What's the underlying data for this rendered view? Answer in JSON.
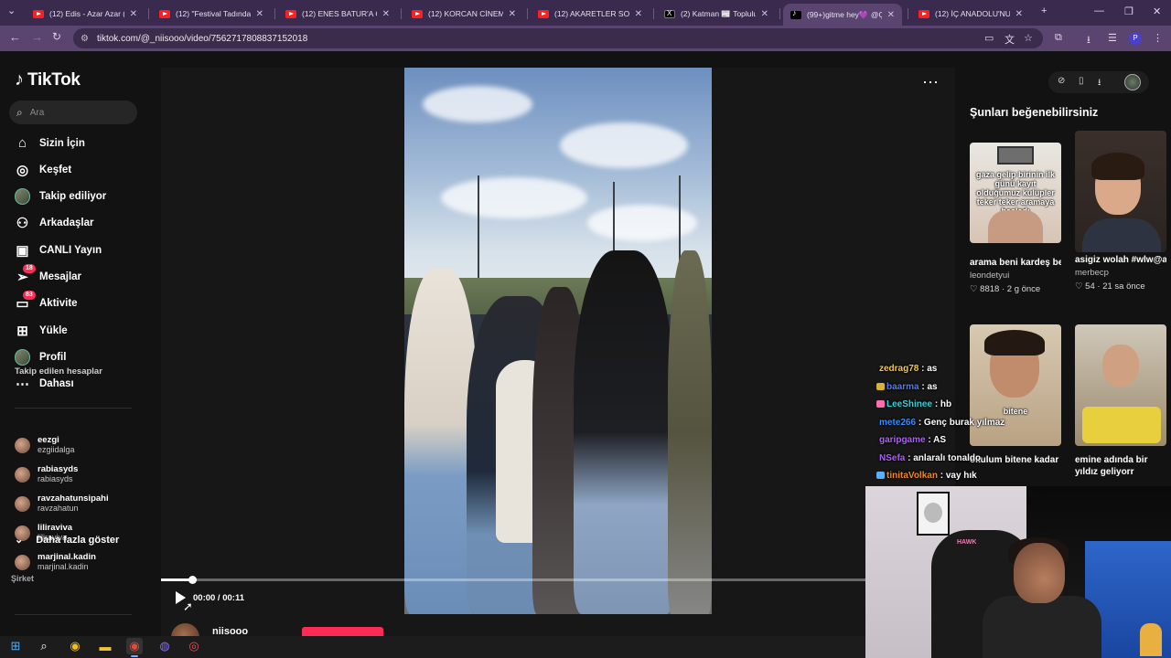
{
  "browser": {
    "tabs": [
      {
        "title": "(12) Edis - Azar Azar (Offi",
        "icon": "youtube-icon"
      },
      {
        "title": "(12) \"Festival Tadında Vid",
        "icon": "youtube-icon"
      },
      {
        "title": "(12) ENES BATUR'A GERÇ",
        "icon": "youtube-icon"
      },
      {
        "title": "(12) KORCAN CİNEMRE E",
        "icon": "youtube-icon"
      },
      {
        "title": "(12) AKARETLER SOKO LE",
        "icon": "youtube-icon"
      },
      {
        "title": "(2) Katman 📰 Topluluk /",
        "icon": "x-icon"
      },
      {
        "title": "(99+)gitme hey💜 @Çağ",
        "icon": "tiktok-icon"
      },
      {
        "title": "(12) İÇ ANADOLU'NUN E",
        "icon": "youtube-icon"
      }
    ],
    "active_tab_index": 6,
    "url": "tiktok.com/@_niisooo/video/7562717808837152018",
    "profile_initial": "P"
  },
  "tiktok": {
    "brand": "TikTok",
    "search_placeholder": "Ara",
    "nav": [
      {
        "label": "Sizin İçin",
        "icon": "home-icon"
      },
      {
        "label": "Keşfet",
        "icon": "compass-icon"
      },
      {
        "label": "Takip ediliyor",
        "icon": "avatar"
      },
      {
        "label": "Arkadaşlar",
        "icon": "friends-icon"
      },
      {
        "label": "CANLI Yayın",
        "icon": "live-icon"
      },
      {
        "label": "Mesajlar",
        "icon": "send-icon",
        "badge": "18"
      },
      {
        "label": "Aktivite",
        "icon": "activity-icon",
        "badge": "83"
      },
      {
        "label": "Yükle",
        "icon": "upload-icon"
      },
      {
        "label": "Profil",
        "icon": "avatar"
      },
      {
        "label": "Dahası",
        "icon": "more-icon"
      }
    ],
    "following_header": "Takip edilen hesaplar",
    "following": [
      {
        "name": "eezgi",
        "username": "ezgiidalga"
      },
      {
        "name": "rabiasyds",
        "username": "rabiasyds"
      },
      {
        "name": "ravzahatunsipahi",
        "username": "ravzahatun"
      },
      {
        "name": "liliraviva",
        "username": "liliraviva"
      },
      {
        "name": "marjinal.kadin",
        "username": "marjinal.kadin"
      }
    ],
    "show_more": "Daha fazla göster",
    "company": "Şirket",
    "player": {
      "time": "00:00 / 00:11",
      "progress": 0.044
    },
    "author_name": "niisooo",
    "recommend_title": "Şunları beğenebilirsiniz",
    "recommendations": [
      {
        "caption": "arama beni kardeş ben gelmicem...",
        "user": "leondetyui",
        "likes": "8818",
        "age": "2 g önce",
        "overlay": "gaza gelip birinin ilk günü kayıt olduğumuz kulüpler teker teker aramaya başladı"
      },
      {
        "caption": "asigiz wolah #wlw@asliihira @e...",
        "user": "merbecp",
        "likes": "54",
        "age": "21 sa önce",
        "overlay": ""
      },
      {
        "caption": "okulum bitene kadar ders",
        "user": "",
        "likes": "",
        "age": "",
        "overlay": "bitene"
      },
      {
        "caption": "emine adında bir yıldız geliyorr",
        "user": "",
        "likes": "",
        "age": "",
        "overlay": ""
      }
    ]
  },
  "stream_chat": [
    {
      "user": "zedrag78",
      "text": ": as",
      "color": "#f5c842"
    },
    {
      "user": "baarma",
      "text": ": as",
      "color": "#4a7bff"
    },
    {
      "user": "LeeShinee",
      "text": ": hb",
      "color": "#3ad0d8"
    },
    {
      "user": "mete266",
      "text": ": Genç burak yılmaz",
      "color": "#3a8cff"
    },
    {
      "user": "garipgame",
      "text": ": AS",
      "color": "#b05cff"
    },
    {
      "user": "NSefa",
      "text": ": anlaralı tonaldo",
      "color": "#b05cff"
    },
    {
      "user": "tinitaVolkan",
      "text": ": vay hık",
      "color": "#f08a1e"
    }
  ],
  "colors": {
    "accent": "#fe2c55",
    "tab_strip": "#3a2a4d",
    "toolbar": "#5a4470"
  }
}
